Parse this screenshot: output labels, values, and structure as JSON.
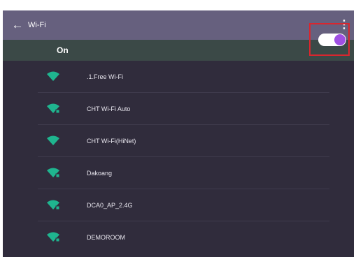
{
  "appbar": {
    "back_icon": "arrow-left-icon",
    "title": "Wi-Fi",
    "more_icon": "more-vert-icon"
  },
  "wifi_toggle": {
    "label": "On",
    "state": "on",
    "accent_color": "#9f4fe3"
  },
  "networks": [
    {
      "ssid": ".1.Free Wi-Fi",
      "icon": "wifi-open-icon"
    },
    {
      "ssid": "CHT Wi-Fi Auto",
      "icon": "wifi-secured-icon"
    },
    {
      "ssid": "CHT Wi-Fi(HiNet)",
      "icon": "wifi-open-icon"
    },
    {
      "ssid": "Dakoang",
      "icon": "wifi-secured-icon"
    },
    {
      "ssid": "DCA0_AP_2.4G",
      "icon": "wifi-secured-icon"
    },
    {
      "ssid": "DEMOROOM",
      "icon": "wifi-secured-icon"
    }
  ],
  "colors": {
    "appbar": "#66607e",
    "toggle_row": "#3b4947",
    "background": "#302c3c",
    "wifi_icon": "#1fb58f",
    "highlight": "#d9262e"
  }
}
